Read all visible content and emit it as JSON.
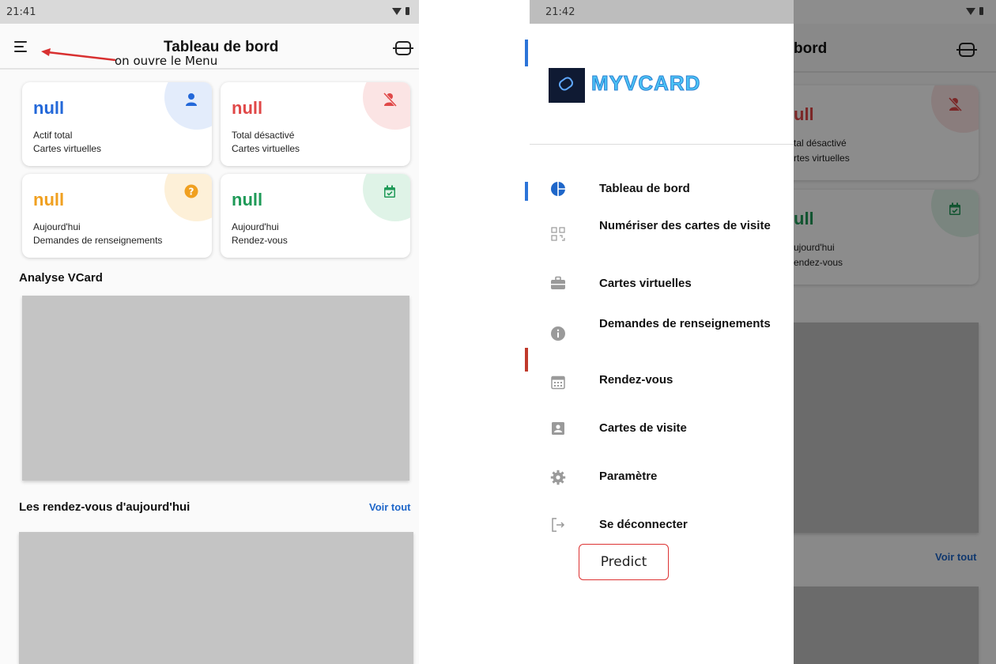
{
  "left_screen": {
    "status_time": "21:41",
    "appbar": {
      "title": "Tableau de bord",
      "menu_icon": "hamburger-menu-icon",
      "scan_icon": "scan-qr-icon"
    },
    "annotation": "on ouvre le Menu",
    "cards": [
      {
        "value": "null",
        "line1": "Actif total",
        "line2": "Cartes virtuelles",
        "color": "#2368d9",
        "tint": "#e3ecfb",
        "icon": "person-icon"
      },
      {
        "value": "null",
        "line1": "Total désactivé",
        "line2": "Cartes virtuelles",
        "color": "#e04848",
        "tint": "#fbe4e4",
        "icon": "person-off-icon"
      },
      {
        "value": "null",
        "line1": "Aujourd'hui",
        "line2": "Demandes de renseignements",
        "color": "#f0a020",
        "tint": "#fdf0d8",
        "icon": "question-icon"
      },
      {
        "value": "null",
        "line1": "Aujourd'hui",
        "line2": "Rendez-vous",
        "color": "#1f9a58",
        "tint": "#dff3e7",
        "icon": "calendar-check-icon"
      }
    ],
    "section_analysis": "Analyse VCard",
    "section_appointments": "Les rendez-vous d'aujourd'hui",
    "see_all": "Voir tout"
  },
  "right_screen": {
    "status_time": "21:42",
    "background": {
      "title_fragment": "bord",
      "card2_value": "ull",
      "card2_line1": "tal désactivé",
      "card2_line2": "rtes virtuelles",
      "card4_value": "ull",
      "card4_line1": "ujourd'hui",
      "card4_line2": "endez-vous",
      "see_all": "Voir tout"
    },
    "drawer": {
      "logo_text": "MYVCARD",
      "items": [
        {
          "label": "Tableau de bord",
          "icon": "pie-chart-icon"
        },
        {
          "label": "Numériser des cartes de visite",
          "icon": "qr-scan-icon"
        },
        {
          "label": "Cartes virtuelles",
          "icon": "briefcase-icon"
        },
        {
          "label": "Demandes de renseignements",
          "icon": "info-icon"
        },
        {
          "label": "Rendez-vous",
          "icon": "calendar-icon"
        },
        {
          "label": "Cartes de visite",
          "icon": "contact-card-icon"
        },
        {
          "label": "Paramètre",
          "icon": "gear-icon"
        },
        {
          "label": "Se déconnecter",
          "icon": "logout-icon"
        }
      ],
      "predict_label": "Predict"
    }
  }
}
